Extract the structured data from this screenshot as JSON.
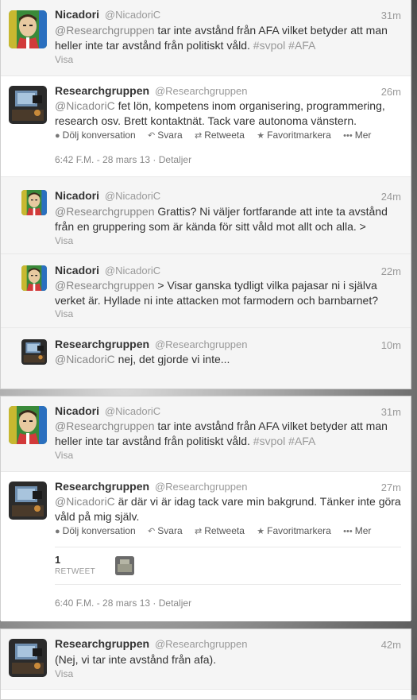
{
  "users": {
    "nicadori": {
      "name": "Nicadori",
      "handle": "@NicadoriC"
    },
    "research": {
      "name": "Researchgruppen",
      "handle": "@Researchgruppen"
    }
  },
  "actions": {
    "hide_conversation": "Dölj konversation",
    "reply": "Svara",
    "retweet": "Retweeta",
    "favorite": "Favoritmarkera",
    "more": "Mer",
    "show": "Visa",
    "details": "Detaljer"
  },
  "tweets": [
    {
      "time": "31m",
      "text_mention": "@Researchgruppen",
      "text_body": " tar inte avstånd från AFA vilket betyder att man heller inte tar avstånd från politiskt våld. ",
      "tags": "#svpol #AFA"
    },
    {
      "time": "26m",
      "text_mention": "@NicadoriC",
      "text_body": " fet lön, kompetens inom organisering, programmering, research osv. Brett kontaktnät. Tack vare autonoma vänstern.",
      "timestamp": "6:42 F.M. - 28 mars 13"
    },
    {
      "time": "24m",
      "text_mention": "@Researchgruppen",
      "text_body": " Grattis? Ni väljer fortfarande att inte ta avstånd från en gruppering som är kända för sitt våld mot allt och alla. >"
    },
    {
      "time": "22m",
      "text_mention": "@Researchgruppen",
      "text_body": " > Visar ganska tydligt vilka pajasar ni i själva verket är. Hyllade ni inte attacken mot farmodern och barnbarnet?"
    },
    {
      "time": "10m",
      "text_mention": "@NicadoriC",
      "text_body": " nej, det gjorde vi inte..."
    },
    {
      "time": "31m",
      "text_mention": "@Researchgruppen",
      "text_body": " tar inte avstånd från AFA vilket betyder att man heller inte tar avstånd från politiskt våld. ",
      "tags": "#svpol #AFA"
    },
    {
      "time": "27m",
      "text_mention": "@NicadoriC",
      "text_body": " är där vi är idag tack vare min bakgrund. Tänker inte göra våld på mig själv.",
      "retweet_count": "1",
      "retweet_label": "RETWEET",
      "timestamp": "6:40 F.M. - 28 mars 13"
    },
    {
      "time": "42m",
      "text_body": "(Nej, vi tar inte avstånd från afa)."
    }
  ]
}
